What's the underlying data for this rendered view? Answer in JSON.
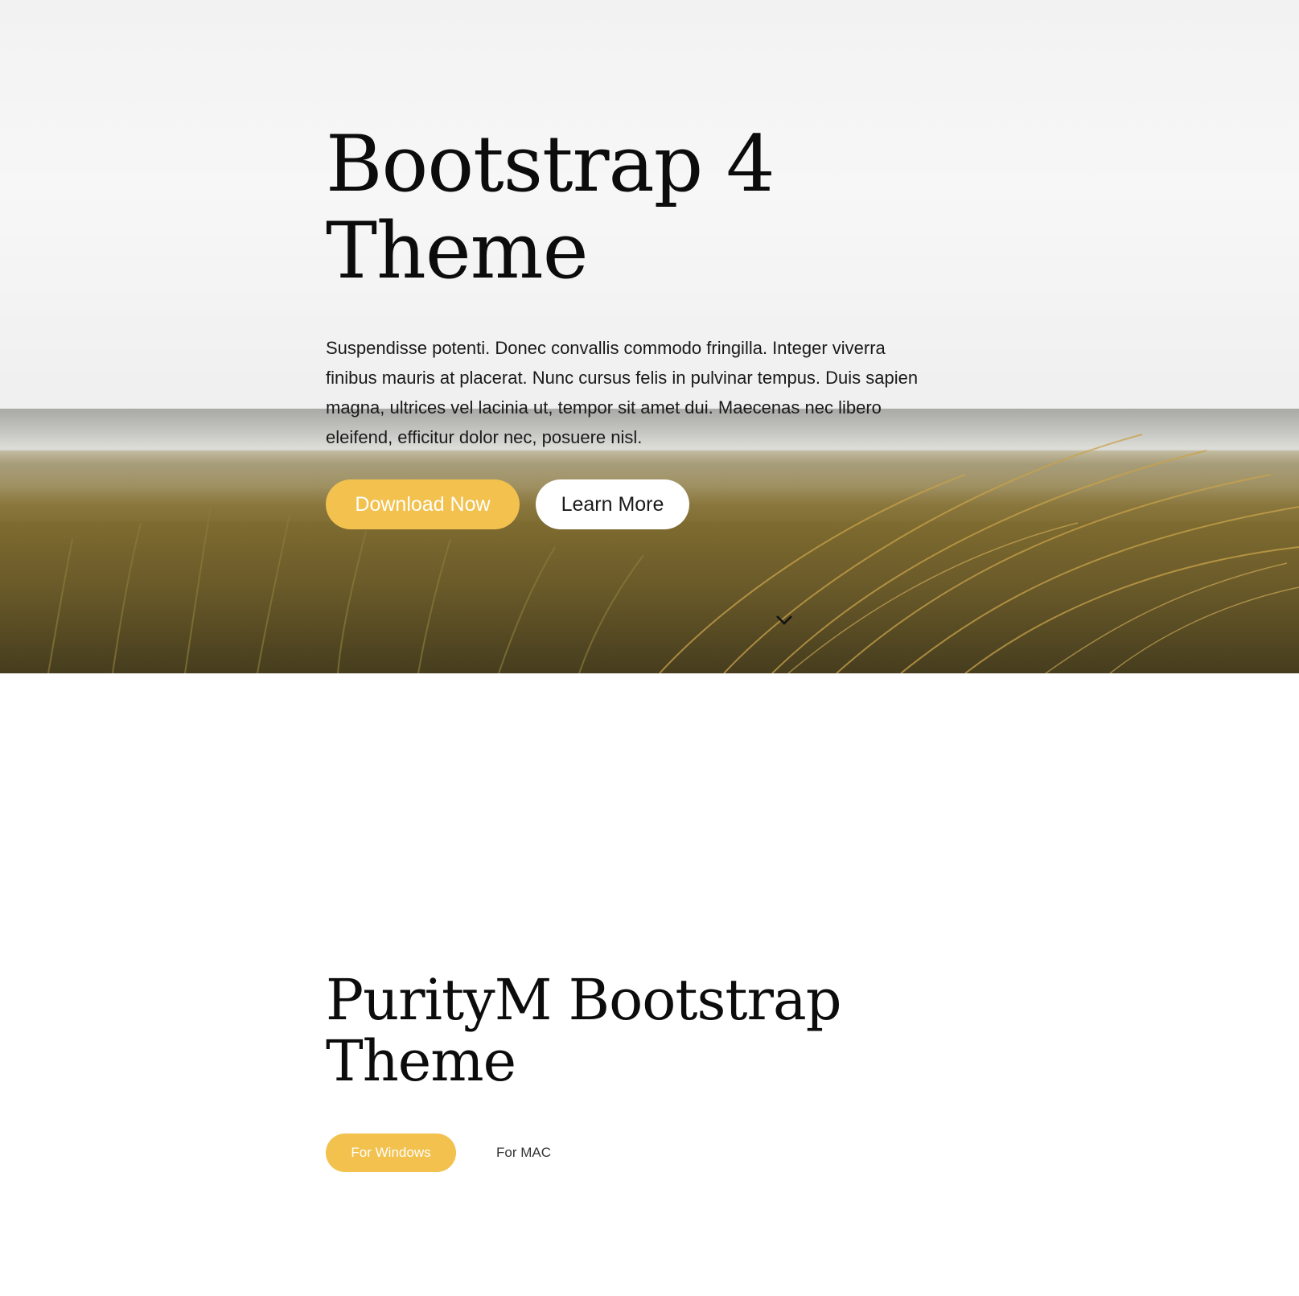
{
  "hero": {
    "title_line1": "Bootstrap 4",
    "title_line2": "Theme",
    "text": "Suspendisse potenti. Donec convallis commodo fringilla. Integer viverra finibus mauris at placerat. Nunc cursus felis in pulvinar tempus. Duis sapien magna, ultrices vel lacinia ut, tempor sit amet dui. Maecenas nec libero eleifend, efficitur dolor nec, posuere nisl.",
    "primary_button": "Download Now",
    "secondary_button": "Learn More",
    "scroll_icon": "chevron-down-icon"
  },
  "section2": {
    "title_line1": "PurityM Bootstrap",
    "title_line2": "Theme",
    "tabs": [
      {
        "label": "For Windows",
        "active": true
      },
      {
        "label": "For MAC",
        "active": false
      }
    ]
  },
  "colors": {
    "accent": "#f2c14e",
    "text": "#111111",
    "background": "#ffffff"
  }
}
